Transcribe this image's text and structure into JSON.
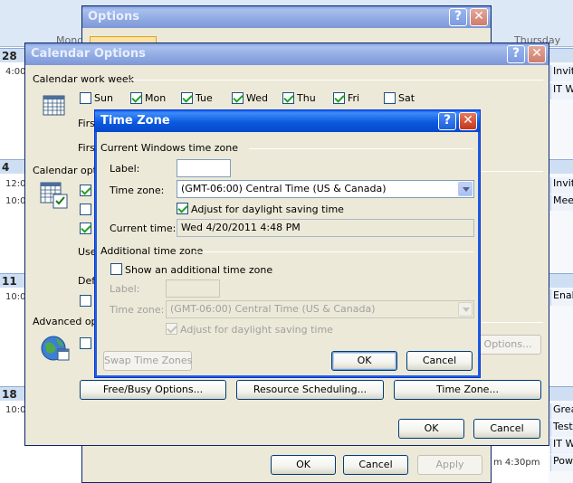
{
  "calendar": {
    "day_left": "Mond",
    "day_right": "Thursday",
    "weeks": [
      {
        "num": "28",
        "time": "4:00"
      },
      {
        "num": "4",
        "time": "12:0",
        "time2": "10:0"
      },
      {
        "num": "11",
        "time": "10:0"
      },
      {
        "num": "18",
        "time": "10:0"
      }
    ],
    "events": [
      "Invit",
      "IT W",
      "Invit",
      "Mee",
      "Enab",
      "Grea",
      "Test",
      "IT W",
      "Pow"
    ],
    "event_time": "m 4:30pm"
  },
  "options_window": {
    "title": "Options",
    "buttons": {
      "ok": "OK",
      "cancel": "Cancel",
      "apply": "Apply"
    }
  },
  "calendar_options": {
    "title": "Calendar Options",
    "work_week_label": "Calendar work week",
    "days": [
      {
        "label": "Sun",
        "checked": false
      },
      {
        "label": "Mon",
        "checked": true
      },
      {
        "label": "Tue",
        "checked": true
      },
      {
        "label": "Wed",
        "checked": true
      },
      {
        "label": "Thu",
        "checked": true
      },
      {
        "label": "Fri",
        "checked": true
      },
      {
        "label": "Sat",
        "checked": false
      }
    ],
    "first_label_1": "Firs",
    "first_label_2": "Firs",
    "calendar_options_label": "Calendar optio",
    "use_label": "Use",
    "def_label": "Def",
    "advanced_label": "Advanced opti",
    "options_button": "Options...",
    "free_busy_button": "Free/Busy Options...",
    "resource_button": "Resource Scheduling...",
    "time_zone_button": "Time Zone...",
    "ok": "OK",
    "cancel": "Cancel"
  },
  "time_zone": {
    "title": "Time Zone",
    "current_group": "Current Windows time zone",
    "label_label": "Label:",
    "label_value": "",
    "time_zone_label": "Time zone:",
    "time_zone_value": "(GMT-06:00) Central Time (US & Canada)",
    "adjust_label": "Adjust for daylight saving time",
    "current_time_label": "Current time:",
    "current_time_value": "Wed 4/20/2011 4:48 PM",
    "additional_group": "Additional time zone",
    "show_additional_label": "Show an additional time zone",
    "add_label_label": "Label:",
    "add_time_zone_label": "Time zone:",
    "add_time_zone_value": "(GMT-06:00) Central Time (US & Canada)",
    "add_adjust_label": "Adjust for daylight saving time",
    "swap_button": "Swap Time Zones",
    "ok": "OK",
    "cancel": "Cancel"
  }
}
